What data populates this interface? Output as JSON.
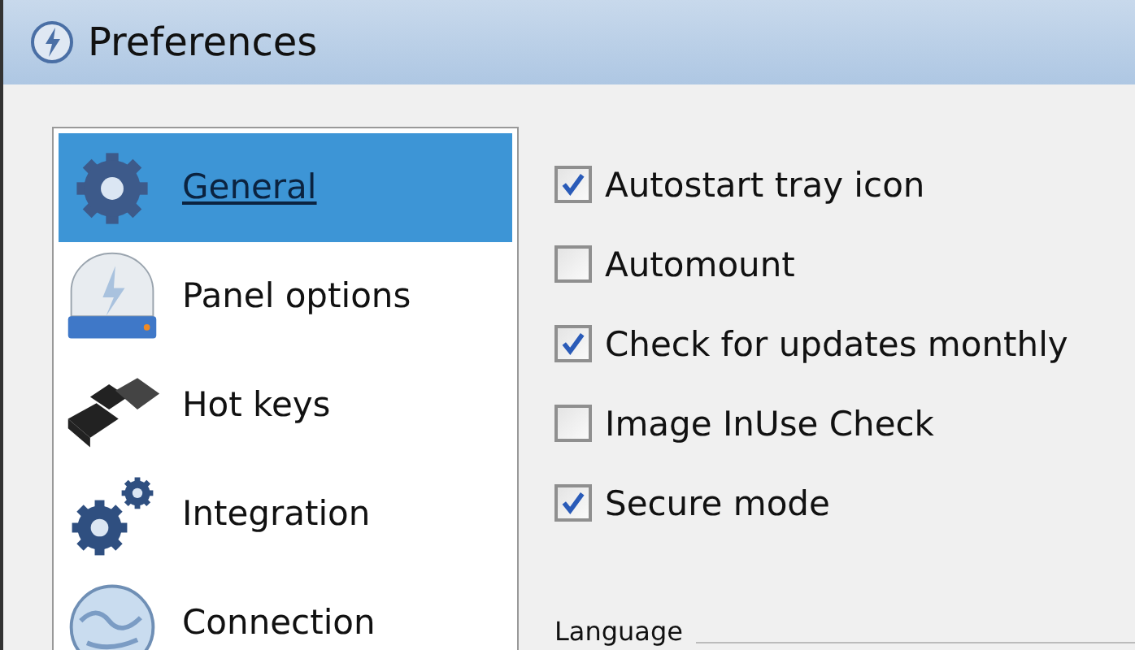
{
  "window": {
    "title": "Preferences"
  },
  "sidebar": {
    "items": [
      {
        "label": "General",
        "kind": "gear",
        "selected": true
      },
      {
        "label": "Panel options",
        "kind": "drive",
        "selected": false
      },
      {
        "label": "Hot keys",
        "kind": "keys",
        "selected": false
      },
      {
        "label": "Integration",
        "kind": "gears",
        "selected": false
      },
      {
        "label": "Connection",
        "kind": "globe",
        "selected": false
      }
    ]
  },
  "options": [
    {
      "label": "Autostart tray icon",
      "checked": true
    },
    {
      "label": "Automount",
      "checked": false
    },
    {
      "label": "Check for updates monthly",
      "checked": true
    },
    {
      "label": "Image InUse Check",
      "checked": false
    },
    {
      "label": "Secure mode",
      "checked": true
    }
  ],
  "language": {
    "label": "Language"
  }
}
